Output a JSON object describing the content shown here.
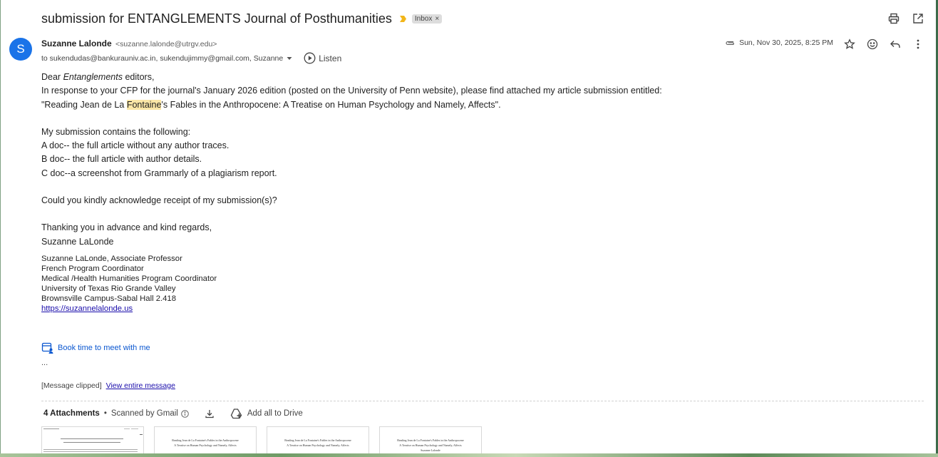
{
  "email": {
    "subject": "submission for ENTANGLEMENTS Journal of Posthumanities",
    "label": "Inbox",
    "label_close": "×",
    "sender_initial": "S",
    "sender_name": "Suzanne Lalonde",
    "sender_email": "<suzanne.lalonde@utrgv.edu>",
    "recipients": "to sukendudas@bankurauniv.ac.in, sukendujimmy@gmail.com, Suzanne",
    "listen_label": "Listen",
    "date": "Sun, Nov 30, 2025, 8:25 PM"
  },
  "body": {
    "greeting_prefix": "Dear ",
    "greeting_em": "Entanglements",
    "greeting_suffix": " editors,",
    "line1": "In response to your CFP for the journal's January 2026 edition (posted on the University of Penn website), please find attached my article submission entitled:",
    "title_prefix": "\"Reading Jean de La ",
    "title_highlight": "Fontaine",
    "title_suffix": "'s Fables in the Anthropocene: A Treatise on Human Psychology and Namely, Affects\".",
    "contains": "My submission contains the following:",
    "item_a": "A doc-- the full article without any author traces.",
    "item_b": "B doc-- the full article with author details.",
    "item_c": "C doc--a screenshot from Grammarly of a plagiarism report.",
    "question": "Could you kindly acknowledge receipt of my submission(s)?",
    "thanks": "Thanking you in advance and kind regards,",
    "name": "Suzanne LaLonde"
  },
  "signature": {
    "line1": "Suzanne LaLonde, Associate Professor",
    "line2": "French Program Coordinator",
    "line3": "Medical /Health Humanities Program Coordinator",
    "line4": "University of Texas Rio Grande Valley",
    "line5": "Brownsville Campus-Sabal Hall 2.418",
    "link": "https://suzannelalonde.us",
    "booking": "Book time to meet with me"
  },
  "clipped": {
    "ellipsis": "...",
    "text": "[Message clipped]",
    "link": "View entire message"
  },
  "attachments": {
    "count": "4 Attachments",
    "separator": "•",
    "scanned": "Scanned by Gmail",
    "add_to_drive": "Add all to Drive",
    "thumb_title": "Reading Jean de La Fontaine's Fables in the Anthropocene",
    "thumb_subtitle": "A Treatise on Human Psychology and Namely, Affects",
    "thumb_author": "Suzanne Lalonde"
  },
  "colors": {
    "accent": "#1a73e8",
    "link": "#1a0dab",
    "highlight": "#fbe6a6",
    "importance": "#f2b61a"
  },
  "icons": [
    "print-icon",
    "open-in-new-icon",
    "attachment-clip-icon",
    "star-icon",
    "emoji-icon",
    "reply-icon",
    "more-vert-icon",
    "play-circle-icon",
    "calendar-person-icon",
    "info-icon",
    "download-icon",
    "add-to-drive-icon"
  ]
}
